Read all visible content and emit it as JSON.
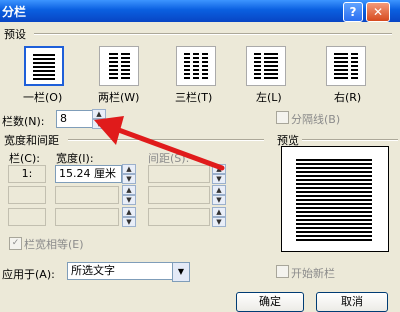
{
  "window": {
    "title": "分栏",
    "help_label": "?",
    "close_label": "✕"
  },
  "presets": {
    "group_label": "预设",
    "items": [
      {
        "label": "一栏(O)",
        "columns": 1
      },
      {
        "label": "两栏(W)",
        "columns": 2
      },
      {
        "label": "三栏(T)",
        "columns": 3
      },
      {
        "label": "左(L)",
        "columns": 2
      },
      {
        "label": "右(R)",
        "columns": 2
      }
    ]
  },
  "column_count": {
    "label": "栏数(N):",
    "value": "8"
  },
  "separator": {
    "label": "分隔线(B)",
    "checked": false
  },
  "width_spacing": {
    "group_label": "宽度和间距",
    "col_header": "栏(C):",
    "width_header": "宽度(I):",
    "spacing_header": "间距(S):",
    "row1_col": "1:",
    "row1_width": "15.24 厘米"
  },
  "equal_width": {
    "label": "栏宽相等(E)",
    "checked": true
  },
  "preview": {
    "label": "预览"
  },
  "apply_to": {
    "label": "应用于(A):",
    "value": "所选文字"
  },
  "new_column": {
    "label": "开始新栏",
    "checked": false
  },
  "buttons": {
    "ok": "确定",
    "cancel": "取消"
  },
  "colors": {
    "titlebar": "#0a5fe0",
    "arrow": "#e01b1b"
  }
}
